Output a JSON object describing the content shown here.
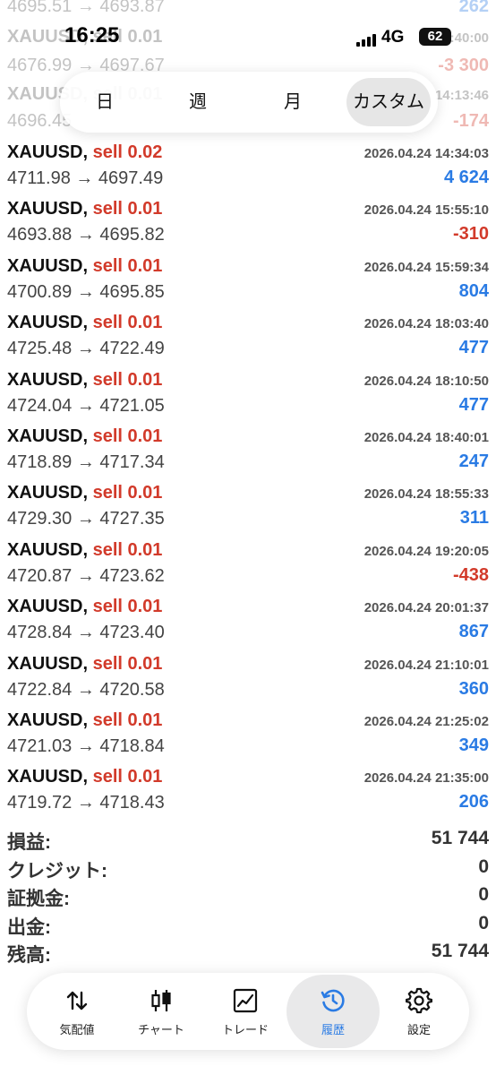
{
  "status_bar": {
    "time": "16:25",
    "network": "4G",
    "battery": "62"
  },
  "faded_rows": [
    {
      "left": "4695.51 → 4693.87",
      "right": "262",
      "tone": "pos"
    },
    {
      "left": "XAUUSD, sell 0.01",
      "right": "14:40:00",
      "tone": "muted"
    },
    {
      "left": "4676.99 → 4697.67",
      "right": "-3 300",
      "tone": "neg"
    },
    {
      "left": "XAUUSD, sell 0.01",
      "right": "14:13:46",
      "tone": "muted"
    },
    {
      "left": "4696.45",
      "right": "-174",
      "tone": "neg"
    }
  ],
  "period_tabs": [
    {
      "label": "日",
      "active": false
    },
    {
      "label": "週",
      "active": false
    },
    {
      "label": "月",
      "active": false
    },
    {
      "label": "カスタム",
      "active": true
    }
  ],
  "trades": [
    {
      "symbol": "XAUUSD,",
      "side": "sell 0.02",
      "datetime": "2026.04.24 14:34:03",
      "prices": "4711.98 → 4697.49",
      "profit": "4 624",
      "tone": "pos"
    },
    {
      "symbol": "XAUUSD,",
      "side": "sell 0.01",
      "datetime": "2026.04.24 15:55:10",
      "prices": "4693.88 → 4695.82",
      "profit": "-310",
      "tone": "neg"
    },
    {
      "symbol": "XAUUSD,",
      "side": "sell 0.01",
      "datetime": "2026.04.24 15:59:34",
      "prices": "4700.89 → 4695.85",
      "profit": "804",
      "tone": "pos"
    },
    {
      "symbol": "XAUUSD,",
      "side": "sell 0.01",
      "datetime": "2026.04.24 18:03:40",
      "prices": "4725.48 → 4722.49",
      "profit": "477",
      "tone": "pos"
    },
    {
      "symbol": "XAUUSD,",
      "side": "sell 0.01",
      "datetime": "2026.04.24 18:10:50",
      "prices": "4724.04 → 4721.05",
      "profit": "477",
      "tone": "pos"
    },
    {
      "symbol": "XAUUSD,",
      "side": "sell 0.01",
      "datetime": "2026.04.24 18:40:01",
      "prices": "4718.89 → 4717.34",
      "profit": "247",
      "tone": "pos"
    },
    {
      "symbol": "XAUUSD,",
      "side": "sell 0.01",
      "datetime": "2026.04.24 18:55:33",
      "prices": "4729.30 → 4727.35",
      "profit": "311",
      "tone": "pos"
    },
    {
      "symbol": "XAUUSD,",
      "side": "sell 0.01",
      "datetime": "2026.04.24 19:20:05",
      "prices": "4720.87 → 4723.62",
      "profit": "-438",
      "tone": "neg"
    },
    {
      "symbol": "XAUUSD,",
      "side": "sell 0.01",
      "datetime": "2026.04.24 20:01:37",
      "prices": "4728.84 → 4723.40",
      "profit": "867",
      "tone": "pos"
    },
    {
      "symbol": "XAUUSD,",
      "side": "sell 0.01",
      "datetime": "2026.04.24 21:10:01",
      "prices": "4722.84 → 4720.58",
      "profit": "360",
      "tone": "pos"
    },
    {
      "symbol": "XAUUSD,",
      "side": "sell 0.01",
      "datetime": "2026.04.24 21:25:02",
      "prices": "4721.03 → 4718.84",
      "profit": "349",
      "tone": "pos"
    },
    {
      "symbol": "XAUUSD,",
      "side": "sell 0.01",
      "datetime": "2026.04.24 21:35:00",
      "prices": "4719.72 → 4718.43",
      "profit": "206",
      "tone": "pos"
    }
  ],
  "summary": [
    {
      "label": "損益:",
      "value": "51 744"
    },
    {
      "label": "クレジット:",
      "value": "0"
    },
    {
      "label": "証拠金:",
      "value": "0"
    },
    {
      "label": "出金:",
      "value": "0"
    },
    {
      "label": "残高:",
      "value": "51 744"
    }
  ],
  "nav": [
    {
      "id": "quotes",
      "label": "気配値",
      "icon": "arrows-updown-icon",
      "active": false
    },
    {
      "id": "chart",
      "label": "チャート",
      "icon": "candlestick-icon",
      "active": false
    },
    {
      "id": "trade",
      "label": "トレード",
      "icon": "line-chart-icon",
      "active": false
    },
    {
      "id": "history",
      "label": "履歴",
      "icon": "history-clock-icon",
      "active": true
    },
    {
      "id": "settings",
      "label": "設定",
      "icon": "gear-icon",
      "active": false
    }
  ],
  "colors": {
    "profit": "#2a7be4",
    "loss": "#d23a2a",
    "active_nav": "#2a7be4"
  }
}
